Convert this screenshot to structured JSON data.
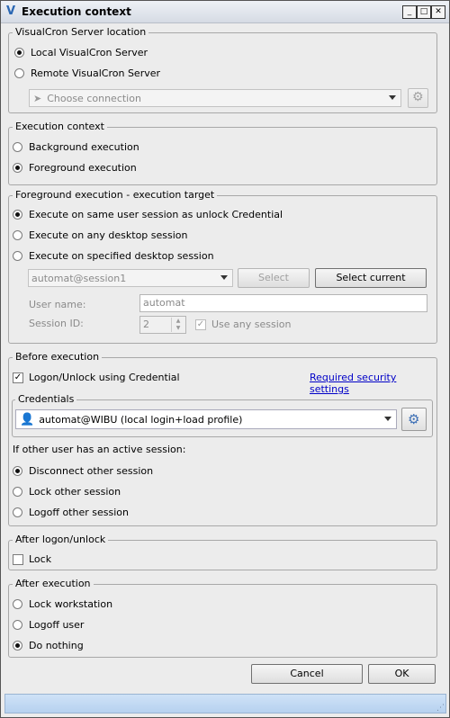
{
  "window": {
    "title": "Execution context",
    "title_icon": "visualcron-logo-icon",
    "controls": {
      "minimize": "_",
      "maximize": "□",
      "close": "✕"
    }
  },
  "server_location": {
    "legend": "VisualCron Server location",
    "local_label": "Local VisualCron Server",
    "local_selected": true,
    "remote_label": "Remote VisualCron Server",
    "remote_selected": false,
    "connection_placeholder": "Choose connection"
  },
  "execution_context": {
    "legend": "Execution context",
    "background_label": "Background execution",
    "background_selected": false,
    "foreground_label": "Foreground execution",
    "foreground_selected": true
  },
  "target": {
    "legend": "Foreground execution - execution target",
    "same_session_label": "Execute on same user session as unlock Credential",
    "same_session_selected": true,
    "any_desktop_label": "Execute on any desktop session",
    "specified_desktop_label": "Execute on specified desktop session",
    "session_value": "automat@session1",
    "select_label": "Select",
    "select_current_label": "Select current",
    "username_label": "User name:",
    "username_value": "automat",
    "session_id_label": "Session ID:",
    "session_id_value": "2",
    "use_any_session_label": "Use any session",
    "use_any_session_checked": true
  },
  "before_execution": {
    "legend": "Before execution",
    "logon_unlock_label": "Logon/Unlock using Credential",
    "logon_unlock_checked": true,
    "security_link": "Required security settings",
    "credentials_legend": "Credentials",
    "credential_value": "automat@WIBU (local login+load profile)",
    "active_session_label": "If other user has an active session:",
    "disconnect_label": "Disconnect other session",
    "disconnect_selected": true,
    "lock_label": "Lock other session",
    "logoff_label": "Logoff other session"
  },
  "after_logon": {
    "legend": "After logon/unlock",
    "lock_label": "Lock",
    "lock_checked": false
  },
  "after_execution": {
    "legend": "After execution",
    "lock_workstation_label": "Lock workstation",
    "logoff_user_label": "Logoff user",
    "do_nothing_label": "Do nothing",
    "do_nothing_selected": true
  },
  "footer": {
    "cancel_label": "Cancel",
    "ok_label": "OK"
  }
}
